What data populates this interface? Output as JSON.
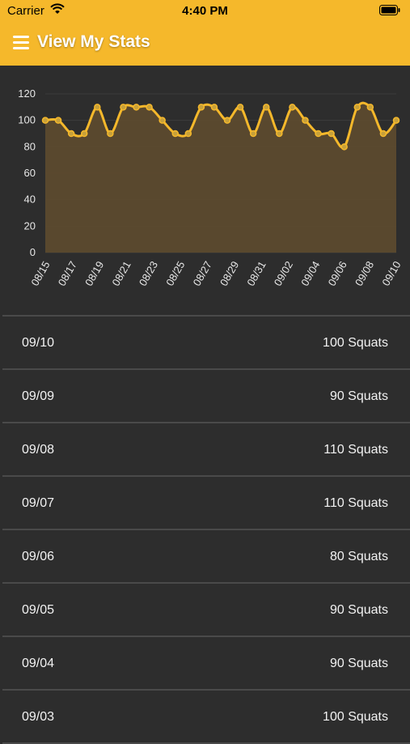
{
  "status_bar": {
    "carrier": "Carrier",
    "time": "4:40 PM"
  },
  "nav": {
    "title": "View My Stats",
    "menu_icon": "hamburger-menu-icon"
  },
  "colors": {
    "accent": "#f5b82b",
    "background": "#2d2d2d",
    "fill": "#5c4a2e",
    "divider": "#4a4a4a"
  },
  "chart_data": {
    "type": "area",
    "x": [
      "08/15",
      "08/16",
      "08/17",
      "08/18",
      "08/19",
      "08/20",
      "08/21",
      "08/22",
      "08/23",
      "08/24",
      "08/25",
      "08/26",
      "08/27",
      "08/28",
      "08/29",
      "08/30",
      "08/31",
      "09/01",
      "09/02",
      "09/03",
      "09/04",
      "09/05",
      "09/06",
      "09/07",
      "09/08",
      "09/09",
      "09/10"
    ],
    "values": [
      100,
      100,
      90,
      90,
      110,
      90,
      110,
      110,
      110,
      100,
      90,
      90,
      110,
      110,
      100,
      110,
      90,
      110,
      90,
      110,
      100,
      90,
      90,
      80,
      110,
      110,
      90,
      100
    ],
    "xticks": [
      "08/15",
      "08/17",
      "08/19",
      "08/21",
      "08/23",
      "08/25",
      "08/27",
      "08/29",
      "08/31",
      "09/02",
      "09/04",
      "09/06",
      "09/08",
      "09/10"
    ],
    "yticks": [
      "120",
      "100",
      "80",
      "60",
      "40",
      "20",
      "0"
    ],
    "ylim": [
      0,
      120
    ],
    "grid": true,
    "title": "",
    "xlabel": "",
    "ylabel": ""
  },
  "entries": [
    {
      "date": "09/10",
      "value": "100 Squats"
    },
    {
      "date": "09/09",
      "value": "90 Squats"
    },
    {
      "date": "09/08",
      "value": "110 Squats"
    },
    {
      "date": "09/07",
      "value": "110 Squats"
    },
    {
      "date": "09/06",
      "value": "80 Squats"
    },
    {
      "date": "09/05",
      "value": "90 Squats"
    },
    {
      "date": "09/04",
      "value": "90 Squats"
    },
    {
      "date": "09/03",
      "value": "100 Squats"
    }
  ]
}
